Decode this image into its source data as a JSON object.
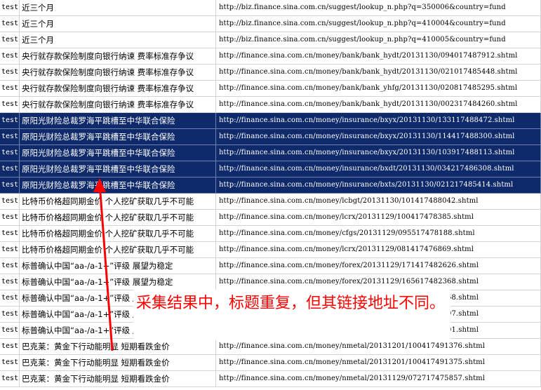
{
  "rows": [
    {
      "tag": "test",
      "title": "近三个月",
      "url": "http://biz.finance.sina.com.cn/suggest/lookup_n.php?q=350006&country=fund",
      "selected": false
    },
    {
      "tag": "test",
      "title": "近三个月",
      "url": "http://biz.finance.sina.com.cn/suggest/lookup_n.php?q=410004&country=fund",
      "selected": false
    },
    {
      "tag": "test",
      "title": "近三个月",
      "url": "http://biz.finance.sina.com.cn/suggest/lookup_n.php?q=410005&country=fund",
      "selected": false
    },
    {
      "tag": "test",
      "title": "央行就存款保险制度向银行纳谏 费率标准存争议",
      "url": "http://finance.sina.com.cn/money/bank/bank_hydt/20131130/094017487912.shtml",
      "selected": false
    },
    {
      "tag": "test",
      "title": "央行就存款保险制度向银行纳谏 费率标准存争议",
      "url": "http://finance.sina.com.cn/money/bank/bank_hydt/20131130/021017485448.shtml",
      "selected": false
    },
    {
      "tag": "test",
      "title": "央行就存款保险制度向银行纳谏 费率标准存争议",
      "url": "http://finance.sina.com.cn/money/bank/bank_yhfg/20131130/020817485295.shtml",
      "selected": false
    },
    {
      "tag": "test",
      "title": "央行就存款保险制度向银行纳谏 费率标准存争议",
      "url": "http://finance.sina.com.cn/money/bank/bank_hydt/20131130/002317484260.shtml",
      "selected": false
    },
    {
      "tag": "test",
      "title": "原阳光财险总裁罗海平跳槽至中华联合保险",
      "url": "http://finance.sina.com.cn/money/insurance/bxyx/20131130/133117488472.shtml",
      "selected": true
    },
    {
      "tag": "test",
      "title": "原阳光财险总裁罗海平跳槽至中华联合保险",
      "url": "http://finance.sina.com.cn/money/insurance/bxyx/20131130/114417488300.shtml",
      "selected": true
    },
    {
      "tag": "test",
      "title": "原阳光财险总裁罗海平跳槽至中华联合保险",
      "url": "http://finance.sina.com.cn/money/insurance/bxyx/20131130/103917488113.shtml",
      "selected": true
    },
    {
      "tag": "test",
      "title": "原阳光财险总裁罗海平跳槽至中华联合保险",
      "url": "http://finance.sina.com.cn/money/insurance/bxdt/20131130/034217486308.shtml",
      "selected": true
    },
    {
      "tag": "test",
      "title": "原阳光财险总裁罗海平跳槽至中华联合保险",
      "url": "http://finance.sina.com.cn/money/insurance/bxts/20131130/021217485414.shtml",
      "selected": true
    },
    {
      "tag": "test",
      "title": "比特币价格超同期金价 个人挖矿获取几乎不可能",
      "url": "http://finance.sina.com.cn/money/lcbgt/20131130/101417488042.shtml",
      "selected": false
    },
    {
      "tag": "test",
      "title": "比特币价格超同期金价 个人挖矿获取几乎不可能",
      "url": "http://finance.sina.com.cn/money/lcrx/20131129/100417478385.shtml",
      "selected": false
    },
    {
      "tag": "test",
      "title": "比特币价格超同期金价 个人挖矿获取几乎不可能",
      "url": "http://finance.sina.com.cn/money/cfgs/20131129/095517478188.shtml",
      "selected": false
    },
    {
      "tag": "test",
      "title": "比特币价格超同期金价 个人挖矿获取几乎不可能",
      "url": "http://finance.sina.com.cn/money/lcrx/20131129/081417476869.shtml",
      "selected": false
    },
    {
      "tag": "test",
      "title": "标普确认中国“aa-/a-1+”评级 展望为稳定",
      "url": "http://finance.sina.com.cn/money/forex/20131129/171417482626.shtml",
      "selected": false
    },
    {
      "tag": "test",
      "title": "标普确认中国“aa-/a-1+”评级 展望为稳定",
      "url": "http://finance.sina.com.cn/money/forex/20131129/165617482368.shtml",
      "selected": false
    },
    {
      "tag": "test",
      "title": "标普确认中国“aa-/a-1+”评级 展望为稳定",
      "url": "http://finance.sina.com.cn/money/forex/20131129/165617482368.shtml",
      "selected": false
    },
    {
      "tag": "test",
      "title": "标普确认中国“aa-/a-1+”评级 展望为稳定",
      "url": "http://finance.sina.com.cn/money/forex/20131129/165617482497.shtml",
      "selected": false
    },
    {
      "tag": "test",
      "title": "标普确认中国“aa-/a-1+”评级 展望为稳定",
      "url": "http://finance.sina.com.cn/money/forex/20131129/165617482701.shtml",
      "selected": false
    },
    {
      "tag": "test",
      "title": "巴克莱：黄金下行动能明显 短期看跌金价",
      "url": "http://finance.sina.com.cn/money/nmetal/20131201/100417491376.shtml",
      "selected": false
    },
    {
      "tag": "test",
      "title": "巴克莱：黄金下行动能明显 短期看跌金价",
      "url": "http://finance.sina.com.cn/money/nmetal/20131201/100417491375.shtml",
      "selected": false
    },
    {
      "tag": "test",
      "title": "巴克莱：黄金下行动能明显 短期看跌金价",
      "url": "http://finance.sina.com.cn/money/nmetal/20131129/072717475857.shtml",
      "selected": false
    }
  ],
  "annotation": {
    "text": "采集结果中，标题重复，但其链接地址不同。",
    "color": "#ff0000"
  },
  "colors": {
    "selected_row_bg": "#0f2a6a",
    "selected_row_text": "#ffffff",
    "grid_line": "#d4d4d4"
  }
}
